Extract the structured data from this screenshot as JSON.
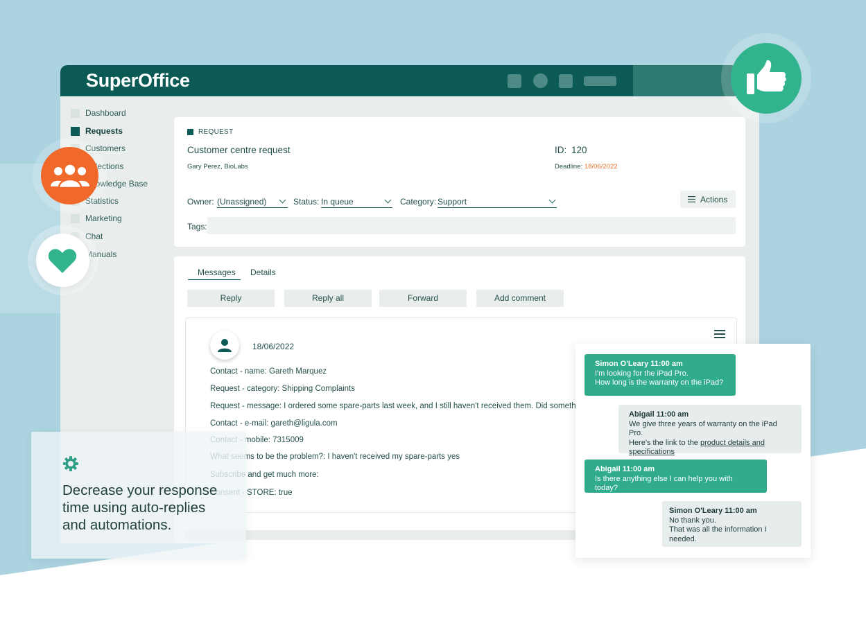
{
  "app": {
    "brand": "SuperOffice"
  },
  "sidebar": {
    "items": [
      {
        "label": "Dashboard"
      },
      {
        "label": "Requests"
      },
      {
        "label": "Customers"
      },
      {
        "label": "Selections"
      },
      {
        "label": "Knowledge Base"
      },
      {
        "label": "Statistics"
      },
      {
        "label": "Marketing"
      },
      {
        "label": "Chat"
      },
      {
        "label": "Manuals"
      }
    ]
  },
  "request": {
    "section_label": "REQUEST",
    "title": "Customer centre request",
    "contact": "Gary Perez, BioLabs",
    "id_label": "ID:",
    "id_value": "120",
    "deadline_label": "Deadline:",
    "deadline_value": "18/06/2022",
    "owner_label": "Owner:",
    "owner_value": "(Unassigned)",
    "status_label": "Status:",
    "status_value": "In queue",
    "category_label": "Category:",
    "category_value": "Support",
    "actions_label": "Actions",
    "tags_label": "Tags:"
  },
  "messages": {
    "tabs": [
      {
        "label": "Messages"
      },
      {
        "label": "Details"
      }
    ],
    "buttons": {
      "reply": "Reply",
      "reply_all": "Reply all",
      "forward": "Forward",
      "add_comment": "Add comment"
    },
    "message": {
      "date": "18/06/2022",
      "lines": [
        "Contact - name: Gareth Marquez",
        "Request - category: Shipping Complaints",
        "Request - message: I ordered some spare-parts last week, and I still haven't received them. Did something go wrong?",
        "Contact - e-mail: gareth@ligula.com",
        "Contact - mobile: 7315009",
        "What seems to be the problem?: I haven't received my spare-parts yes",
        "Subscribe and get much more:",
        "Consent - STORE: true"
      ]
    }
  },
  "chat": {
    "messages": [
      {
        "name": "Simon O'Leary 11:00 am",
        "lines": [
          "I'm looking for the iPad Pro.",
          "How long is the warranty on the iPad?"
        ]
      },
      {
        "name": "Abigail 11:00 am",
        "lines": [
          "We give three years of warranty on  the iPad Pro.",
          "Here's the link to the "
        ],
        "link1": "product details and",
        "link2": "specifications"
      },
      {
        "name": "Abigail 11:00 am",
        "lines": [
          "Is there anything else I can help you with today?"
        ]
      },
      {
        "name": "Simon O'Leary 11:00 am",
        "lines": [
          "No thank you.",
          "That was all the information I needed."
        ]
      }
    ]
  },
  "feature": {
    "text": "Decrease your response time using auto-replies and automations."
  },
  "icons": {
    "thumbs_up": "thumbs-up-icon",
    "people": "people-icon",
    "heart": "heart-icon",
    "gear": "gear-icon",
    "user": "user-icon",
    "menu": "hamburger-icon"
  },
  "colors": {
    "brand_dark": "#0c5a55",
    "accent_green": "#30ab8c",
    "accent_orange": "#f0682a",
    "deadline_orange": "#e8732f",
    "background_blue": "#abd3e0"
  }
}
